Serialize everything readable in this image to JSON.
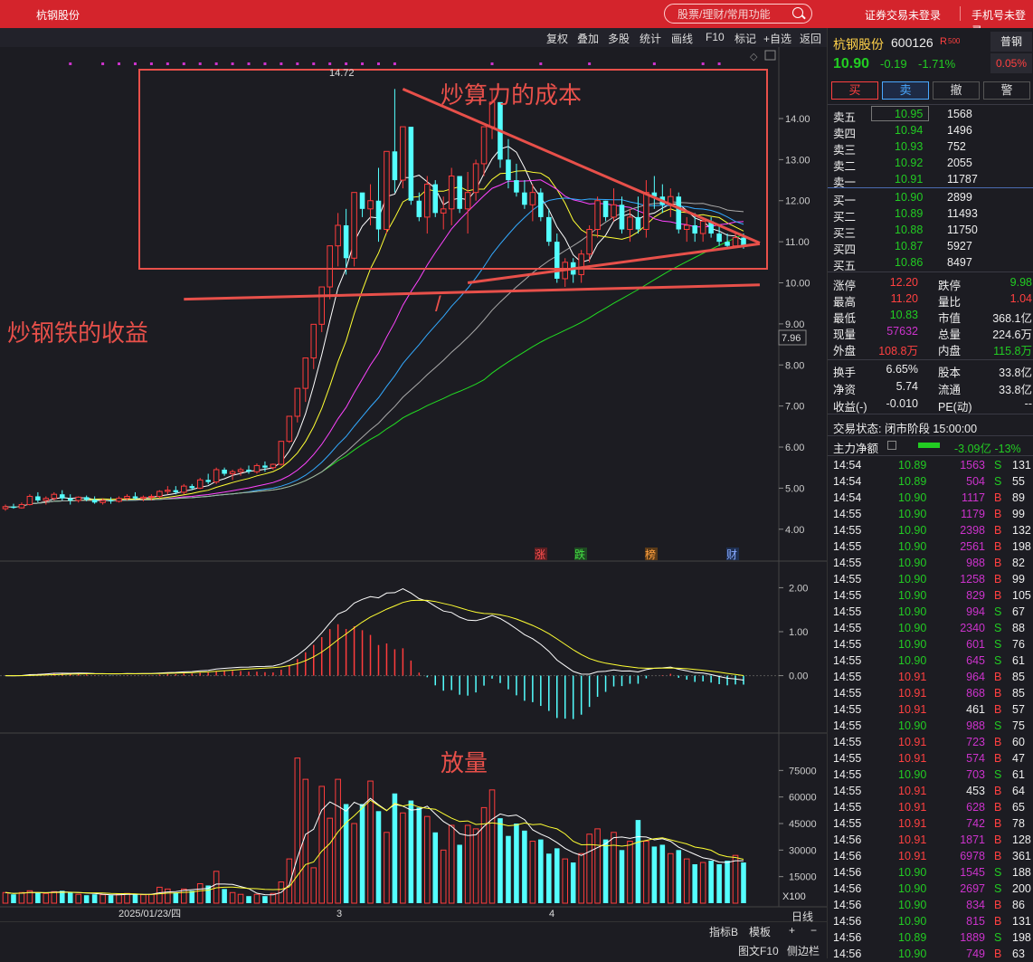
{
  "window": {
    "title": "杭钢股份"
  },
  "search": {
    "placeholder": "股票/理财/常用功能"
  },
  "topbar": {
    "trade_login": "证券交易未登录",
    "phone_login": "手机号未登录"
  },
  "toolbar": {
    "items": [
      "复权",
      "叠加",
      "多股",
      "统计",
      "画线",
      "F10",
      "标记",
      "+自选",
      "返回"
    ]
  },
  "chart_markers": [
    "涨",
    "跌",
    "榜",
    "财"
  ],
  "annotations": {
    "cost": "炒算力的成本",
    "gain": "炒钢铁的收益",
    "volume": "放量",
    "slash": "/"
  },
  "kline_labels": {
    "high_mark": "14.72",
    "current_tag": "7.96",
    "volume_unit": "X100",
    "date": "2025/01/23/四",
    "month3": "3",
    "month4": "4"
  },
  "colors": {
    "up": "#ff3c3c",
    "down": "#54ffff",
    "green": "#22cc22",
    "annotation": "#e8504a",
    "background": "#1c1c22"
  },
  "chart_data": {
    "type": "candlestick",
    "price_axis": {
      "ticks": [
        "14.00",
        "13.00",
        "12.00",
        "11.00",
        "10.00",
        "9.00",
        "8.00",
        "7.00",
        "6.00",
        "5.00",
        "4.00"
      ],
      "ylim": [
        3.4,
        15.3
      ]
    },
    "macd_axis": {
      "ticks": [
        "2.00",
        "1.00",
        "0.00"
      ],
      "ylim": [
        -1.1,
        2.4
      ]
    },
    "volume_axis": {
      "ticks": [
        "75000",
        "60000",
        "45000",
        "30000",
        "15000"
      ],
      "ylim": [
        0,
        90000
      ]
    },
    "candles": [
      [
        4.5,
        4.6,
        4.45,
        4.55,
        6000
      ],
      [
        4.55,
        4.62,
        4.5,
        4.52,
        5000
      ],
      [
        4.52,
        4.65,
        4.5,
        4.6,
        6000
      ],
      [
        4.6,
        4.85,
        4.58,
        4.8,
        7000
      ],
      [
        4.8,
        4.9,
        4.65,
        4.7,
        6000
      ],
      [
        4.7,
        4.8,
        4.6,
        4.75,
        5500
      ],
      [
        4.75,
        4.9,
        4.7,
        4.85,
        6500
      ],
      [
        4.85,
        4.95,
        4.7,
        4.75,
        7000
      ],
      [
        4.75,
        4.85,
        4.6,
        4.7,
        6000
      ],
      [
        4.7,
        4.8,
        4.65,
        4.78,
        5000
      ],
      [
        4.78,
        4.82,
        4.68,
        4.72,
        4500
      ],
      [
        4.72,
        4.8,
        4.62,
        4.65,
        5000
      ],
      [
        4.65,
        4.75,
        4.6,
        4.7,
        4800
      ],
      [
        4.7,
        4.78,
        4.62,
        4.68,
        4500
      ],
      [
        4.68,
        4.8,
        4.65,
        4.75,
        5000
      ],
      [
        4.75,
        4.85,
        4.7,
        4.8,
        5500
      ],
      [
        4.8,
        4.9,
        4.72,
        4.75,
        5000
      ],
      [
        4.75,
        4.82,
        4.68,
        4.78,
        4800
      ],
      [
        4.78,
        4.85,
        4.7,
        4.8,
        5000
      ],
      [
        4.8,
        4.95,
        4.75,
        4.92,
        9000
      ],
      [
        4.92,
        5.05,
        4.85,
        4.95,
        8000
      ],
      [
        4.95,
        5.05,
        4.85,
        4.9,
        6000
      ],
      [
        4.9,
        5.1,
        4.85,
        5.05,
        8000
      ],
      [
        5.05,
        5.1,
        4.95,
        5.0,
        7000
      ],
      [
        5.0,
        5.25,
        4.98,
        5.2,
        11000
      ],
      [
        5.2,
        5.35,
        5.1,
        5.15,
        10000
      ],
      [
        5.15,
        5.5,
        5.1,
        5.45,
        18000
      ],
      [
        5.45,
        5.5,
        5.3,
        5.35,
        8000
      ],
      [
        5.35,
        5.45,
        5.2,
        5.4,
        6000
      ],
      [
        5.4,
        5.5,
        5.3,
        5.45,
        5000
      ],
      [
        5.45,
        5.55,
        5.35,
        5.4,
        4000
      ],
      [
        5.4,
        5.6,
        5.35,
        5.55,
        5000
      ],
      [
        5.55,
        5.65,
        5.4,
        5.5,
        4000
      ],
      [
        5.5,
        5.6,
        5.45,
        5.58,
        5500
      ],
      [
        5.58,
        6.14,
        5.55,
        6.14,
        12000
      ],
      [
        6.14,
        6.75,
        6.1,
        6.75,
        25000
      ],
      [
        6.75,
        7.43,
        6.6,
        7.43,
        82000
      ],
      [
        7.43,
        8.17,
        7.1,
        8.17,
        70000
      ],
      [
        8.17,
        8.99,
        7.9,
        8.99,
        20000
      ],
      [
        8.99,
        9.9,
        8.8,
        9.9,
        66000
      ],
      [
        9.9,
        10.9,
        9.6,
        10.9,
        48000
      ],
      [
        10.9,
        11.7,
        10.4,
        11.4,
        70000
      ],
      [
        11.4,
        11.8,
        10.2,
        10.6,
        56000
      ],
      [
        10.6,
        12.2,
        10.4,
        12.2,
        45000
      ],
      [
        12.2,
        11.9,
        11.6,
        11.8,
        56000
      ],
      [
        11.8,
        12.4,
        11.4,
        12.0,
        69000
      ],
      [
        12.0,
        12.8,
        11.0,
        11.3,
        52000
      ],
      [
        11.3,
        13.2,
        11.2,
        13.2,
        40000
      ],
      [
        13.2,
        14.72,
        12.2,
        12.5,
        62000
      ],
      [
        12.5,
        13.8,
        12.3,
        13.8,
        51000
      ],
      [
        13.8,
        13.5,
        11.9,
        12.0,
        58000
      ],
      [
        12.0,
        12.2,
        11.5,
        11.6,
        54000
      ],
      [
        11.6,
        12.6,
        11.2,
        12.4,
        49000
      ],
      [
        12.4,
        12.5,
        11.6,
        11.7,
        40000
      ],
      [
        11.7,
        12.1,
        11.3,
        11.8,
        30000
      ],
      [
        11.8,
        12.8,
        11.4,
        12.6,
        44000
      ],
      [
        12.6,
        12.4,
        11.7,
        11.8,
        33000
      ],
      [
        11.8,
        12.7,
        11.2,
        12.2,
        44000
      ],
      [
        12.2,
        13.0,
        12.0,
        12.9,
        42000
      ],
      [
        12.9,
        13.8,
        12.6,
        13.8,
        54000
      ],
      [
        13.8,
        14.7,
        13.5,
        14.4,
        64000
      ],
      [
        14.4,
        13.5,
        12.8,
        13.0,
        48000
      ],
      [
        13.0,
        13.5,
        12.3,
        12.5,
        38000
      ],
      [
        12.5,
        12.9,
        12.1,
        12.2,
        45000
      ],
      [
        12.2,
        12.5,
        11.8,
        11.9,
        41000
      ],
      [
        11.9,
        12.4,
        11.5,
        12.2,
        35000
      ],
      [
        12.2,
        12.3,
        11.5,
        11.6,
        36000
      ],
      [
        11.6,
        11.8,
        10.9,
        11.0,
        28000
      ],
      [
        11.0,
        11.2,
        10.0,
        10.1,
        31000
      ],
      [
        10.1,
        10.6,
        9.9,
        10.5,
        25000
      ],
      [
        10.5,
        10.6,
        10.0,
        10.2,
        23000
      ],
      [
        10.2,
        10.8,
        10.0,
        10.7,
        28000
      ],
      [
        10.7,
        11.4,
        10.5,
        11.3,
        39000
      ],
      [
        11.3,
        12.1,
        11.1,
        12.0,
        42000
      ],
      [
        12.0,
        12.0,
        11.5,
        11.6,
        36000
      ],
      [
        11.6,
        12.3,
        11.5,
        11.9,
        40000
      ],
      [
        11.9,
        12.1,
        11.2,
        11.3,
        30000
      ],
      [
        11.3,
        11.8,
        11.0,
        11.6,
        35000
      ],
      [
        11.6,
        12.1,
        11.2,
        11.3,
        47000
      ],
      [
        11.3,
        12.5,
        11.1,
        12.2,
        35000
      ],
      [
        12.2,
        12.6,
        11.8,
        12.1,
        32000
      ],
      [
        12.1,
        12.4,
        11.7,
        11.9,
        33000
      ],
      [
        11.9,
        12.3,
        11.6,
        12.1,
        28000
      ],
      [
        12.1,
        12.2,
        11.2,
        11.3,
        30000
      ],
      [
        11.3,
        11.6,
        11.0,
        11.4,
        25000
      ],
      [
        11.4,
        11.7,
        11.0,
        11.2,
        22000
      ],
      [
        11.2,
        11.6,
        11.0,
        11.5,
        23000
      ],
      [
        11.5,
        11.6,
        11.1,
        11.2,
        24000
      ],
      [
        11.2,
        11.4,
        10.9,
        11.0,
        22000
      ],
      [
        11.0,
        11.2,
        10.85,
        10.9,
        24000
      ],
      [
        10.9,
        11.2,
        10.85,
        11.1,
        27000
      ],
      [
        11.1,
        11.2,
        10.83,
        10.9,
        23000
      ]
    ],
    "trendlines": [
      {
        "from": [
          49,
          14.72
        ],
        "to": [
          93,
          10.97
        ]
      },
      {
        "from": [
          57,
          10.0
        ],
        "to": [
          93,
          10.95
        ]
      },
      {
        "from": [
          22,
          9.6
        ],
        "to": [
          93,
          9.95
        ]
      }
    ]
  },
  "quote": {
    "name": "杭钢股份",
    "code": "600126",
    "flag": "R",
    "flag2": "500",
    "tag": "普钢",
    "price": "10.90",
    "change": "-0.19",
    "change_pct": "-1.71%",
    "ratio": "0.05%",
    "actions": [
      "买",
      "卖",
      "撤",
      "警"
    ],
    "asks": [
      [
        "卖五",
        "10.95",
        "1568"
      ],
      [
        "卖四",
        "10.94",
        "1496"
      ],
      [
        "卖三",
        "10.93",
        "752"
      ],
      [
        "卖二",
        "10.92",
        "2055"
      ],
      [
        "卖一",
        "10.91",
        "11787"
      ]
    ],
    "bids": [
      [
        "买一",
        "10.90",
        "2899"
      ],
      [
        "买二",
        "10.89",
        "11493"
      ],
      [
        "买三",
        "10.88",
        "11750"
      ],
      [
        "买四",
        "10.87",
        "5927"
      ],
      [
        "买五",
        "10.86",
        "8497"
      ]
    ],
    "stats": [
      [
        "涨停",
        "12.20",
        "跌停",
        "9.98"
      ],
      [
        "最高",
        "11.20",
        "量比",
        "1.04"
      ],
      [
        "最低",
        "10.83",
        "市值",
        "368.1亿"
      ],
      [
        "现量",
        "57632",
        "总量",
        "224.6万"
      ],
      [
        "外盘",
        "108.8万",
        "内盘",
        "115.8万"
      ]
    ],
    "stats2": [
      [
        "换手",
        "6.65%",
        "股本",
        "33.8亿"
      ],
      [
        "净资",
        "5.74",
        "流通",
        "33.8亿"
      ],
      [
        "收益(-)",
        "-0.010",
        "PE(动)",
        "--"
      ]
    ],
    "status": "交易状态: 闭市阶段 15:00:00",
    "flow_label": "主力净额",
    "flow_value": "-3.09亿 -13%"
  },
  "ticks": [
    [
      "14:54",
      "10.89",
      "1563",
      "S",
      "131"
    ],
    [
      "14:54",
      "10.89",
      "504",
      "S",
      "55"
    ],
    [
      "14:54",
      "10.90",
      "1117",
      "B",
      "89"
    ],
    [
      "14:55",
      "10.90",
      "1179",
      "B",
      "99"
    ],
    [
      "14:55",
      "10.90",
      "2398",
      "B",
      "132"
    ],
    [
      "14:55",
      "10.90",
      "2561",
      "B",
      "198"
    ],
    [
      "14:55",
      "10.90",
      "988",
      "B",
      "82"
    ],
    [
      "14:55",
      "10.90",
      "1258",
      "B",
      "99"
    ],
    [
      "14:55",
      "10.90",
      "829",
      "B",
      "105"
    ],
    [
      "14:55",
      "10.90",
      "994",
      "S",
      "67"
    ],
    [
      "14:55",
      "10.90",
      "2340",
      "S",
      "88"
    ],
    [
      "14:55",
      "10.90",
      "601",
      "S",
      "76"
    ],
    [
      "14:55",
      "10.90",
      "645",
      "S",
      "61"
    ],
    [
      "14:55",
      "10.91",
      "964",
      "B",
      "85"
    ],
    [
      "14:55",
      "10.91",
      "868",
      "B",
      "85"
    ],
    [
      "14:55",
      "10.91",
      "461",
      "B",
      "57"
    ],
    [
      "14:55",
      "10.90",
      "988",
      "S",
      "75"
    ],
    [
      "14:55",
      "10.91",
      "723",
      "B",
      "60"
    ],
    [
      "14:55",
      "10.91",
      "574",
      "B",
      "47"
    ],
    [
      "14:55",
      "10.90",
      "703",
      "S",
      "61"
    ],
    [
      "14:55",
      "10.91",
      "453",
      "B",
      "64"
    ],
    [
      "14:55",
      "10.91",
      "628",
      "B",
      "65"
    ],
    [
      "14:55",
      "10.91",
      "742",
      "B",
      "78"
    ],
    [
      "14:56",
      "10.91",
      "1871",
      "B",
      "128"
    ],
    [
      "14:56",
      "10.91",
      "6978",
      "B",
      "361"
    ],
    [
      "14:56",
      "10.90",
      "1545",
      "S",
      "188"
    ],
    [
      "14:56",
      "10.90",
      "2697",
      "S",
      "200"
    ],
    [
      "14:56",
      "10.90",
      "834",
      "B",
      "86"
    ],
    [
      "14:56",
      "10.90",
      "815",
      "B",
      "131"
    ],
    [
      "14:56",
      "10.89",
      "1889",
      "S",
      "198"
    ],
    [
      "14:56",
      "10.90",
      "749",
      "B",
      "63"
    ]
  ],
  "bottom": {
    "items": [
      "指标B",
      "模板",
      "+",
      "−",
      "图文F10",
      "侧边栏"
    ],
    "period": "日线"
  }
}
